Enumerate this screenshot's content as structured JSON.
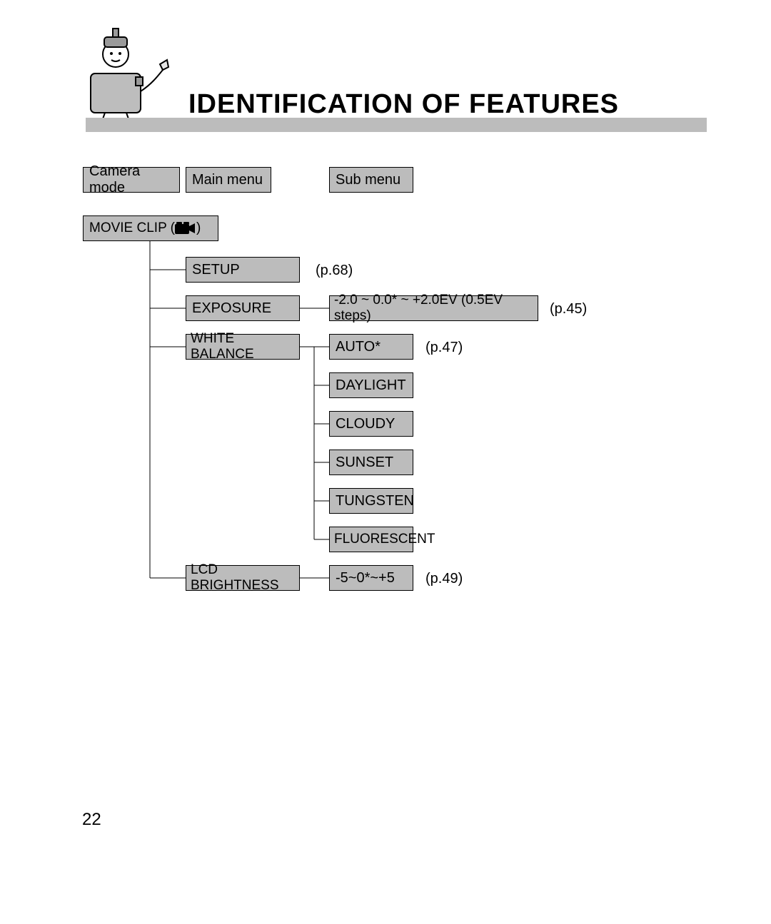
{
  "header": {
    "title": "IDENTIFICATION OF FEATURES"
  },
  "columns": {
    "camera_mode": "Camera mode",
    "main_menu": "Main menu",
    "sub_menu": "Sub menu"
  },
  "mode": {
    "label_prefix": "MOVIE CLIP (",
    "label_suffix": " )"
  },
  "menu": {
    "setup": {
      "label": "SETUP",
      "pref": "(p.68)"
    },
    "exposure": {
      "label": "EXPOSURE",
      "pref": "(p.45)",
      "value": "-2.0 ~ 0.0* ~ +2.0EV (0.5EV steps)"
    },
    "white_balance": {
      "label": "WHITE BALANCE",
      "pref": "(p.47)",
      "options": [
        "AUTO*",
        "DAYLIGHT",
        "CLOUDY",
        "SUNSET",
        "TUNGSTEN",
        "FLUORESCENT"
      ]
    },
    "lcd_brightness": {
      "label": "LCD BRIGHTNESS",
      "pref": "(p.49)",
      "value": "-5~0*~+5"
    }
  },
  "page_number": "22"
}
